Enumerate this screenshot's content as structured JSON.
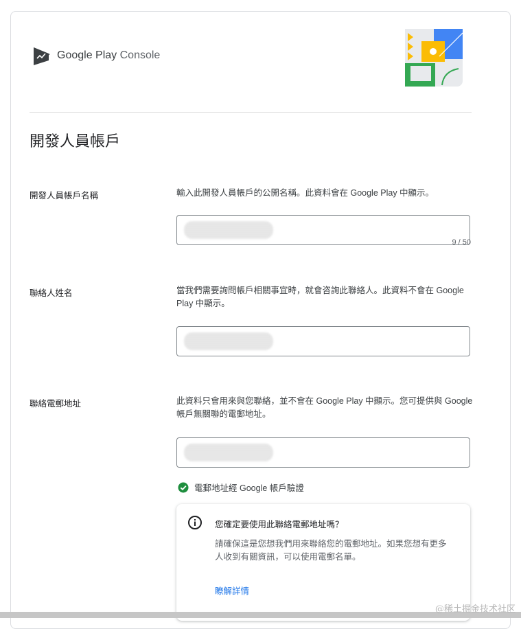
{
  "header": {
    "logo_word1": "Google Play",
    "logo_word2": "Console"
  },
  "section": {
    "title": "開發人員帳戶"
  },
  "fields": {
    "developer_name": {
      "label": "開發人員帳戶名稱",
      "description": "輸入此開發人員帳戶的公開名稱。此資料會在 Google Play 中顯示。",
      "counter": "9 / 50"
    },
    "contact_name": {
      "label": "聯絡人姓名",
      "description": "當我們需要詢問帳戶相關事宜時，就會咨詢此聯絡人。此資料不會在 Google Play 中顯示。"
    },
    "contact_email": {
      "label": "聯絡電郵地址",
      "description": "此資料只會用來與您聯絡，並不會在 Google Play 中顯示。您可提供與 Google 帳戶無關聯的電郵地址。"
    }
  },
  "verification": {
    "text": "電郵地址經 Google 帳戶驗證"
  },
  "info_box": {
    "title": "您確定要使用此聯絡電郵地址嗎？",
    "body": "請確保這是您想我們用來聯絡您的電郵地址。如果您想有更多人收到有關資訊，可以使用電郵名單。",
    "link": "瞭解詳情"
  },
  "watermark": "@稀土掘金技术社区",
  "colors": {
    "accent": "#1a73e8",
    "success": "#1e8e3e",
    "border": "#80868b"
  }
}
